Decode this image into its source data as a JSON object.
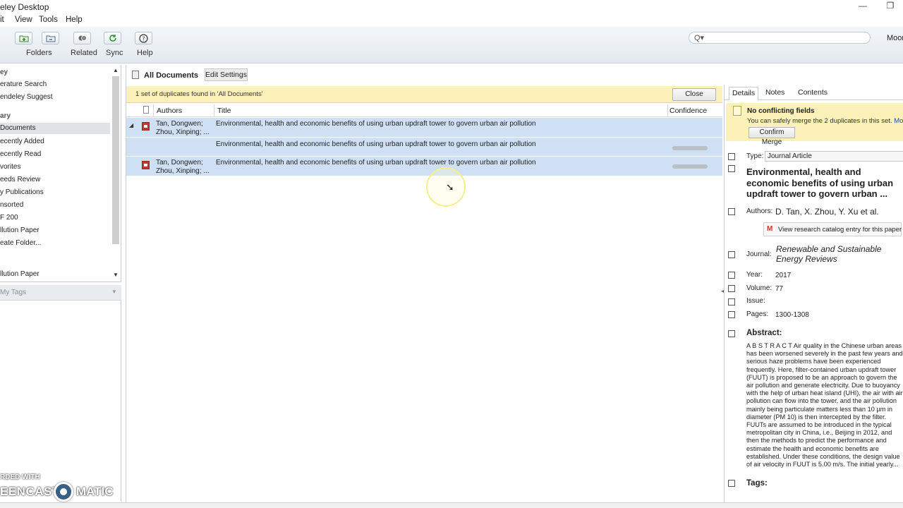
{
  "window": {
    "title": "eley Desktop",
    "minimize_glyph": "—",
    "restore_glyph": "❐"
  },
  "menu": [
    "it",
    "View",
    "Tools",
    "Help"
  ],
  "toolbar": {
    "buttons": [
      {
        "label": "Folders",
        "icon": "add-folder-icon"
      },
      {
        "label": "Related",
        "icon": "related-icon"
      },
      {
        "label": "Sync",
        "icon": "sync-icon"
      },
      {
        "label": "Help",
        "icon": "help-icon"
      }
    ],
    "search_icon": "Q▾",
    "user": "Moon"
  },
  "sidebar": {
    "items": [
      {
        "label": "ey",
        "kind": "section"
      },
      {
        "label": "erature Search",
        "kind": "item"
      },
      {
        "label": "endeley Suggest",
        "kind": "item"
      },
      {
        "label": "ary",
        "kind": "section"
      },
      {
        "label": "Documents",
        "kind": "selected"
      },
      {
        "label": "ecently Added",
        "kind": "item"
      },
      {
        "label": "ecently Read",
        "kind": "item"
      },
      {
        "label": "vorites",
        "kind": "item"
      },
      {
        "label": "eeds Review",
        "kind": "item"
      },
      {
        "label": "y Publications",
        "kind": "item"
      },
      {
        "label": "nsorted",
        "kind": "item"
      },
      {
        "label": "F 200",
        "kind": "item"
      },
      {
        "label": "llution Paper",
        "kind": "item"
      },
      {
        "label": "eate Folder...",
        "kind": "item"
      },
      {
        "label": "llution Paper",
        "kind": "item"
      }
    ],
    "tags_label": "My Tags"
  },
  "center": {
    "title": "All Documents",
    "edit_settings": "Edit Settings",
    "duplicate_notice": "1 set of duplicates found in 'All Documents'",
    "close_label": "Close",
    "columns": {
      "authors": "Authors",
      "title": "Title",
      "confidence": "Confidence"
    },
    "rows": [
      {
        "authors": "Tan, Dongwen;\nZhou, Xinping; ...",
        "title": "Environmental, health and economic benefits of using urban updraft tower to govern urban air pollution",
        "has_pdf": true,
        "expander": "◢",
        "confidence": null
      },
      {
        "authors": "",
        "title": "Environmental, health and economic benefits of using urban updraft tower to govern urban air pollution",
        "has_pdf": false,
        "expander": "",
        "confidence": "high"
      },
      {
        "authors": "Tan, Dongwen;\nZhou, Xinping; ...",
        "title": "Environmental, health and economic benefits of using urban updraft tower to govern urban air pollution",
        "has_pdf": true,
        "expander": "",
        "confidence": "high"
      }
    ]
  },
  "details": {
    "tabs": [
      "Details",
      "Notes",
      "Contents"
    ],
    "merge_title": "No conflicting fields",
    "merge_text": "You can safely merge the 2 duplicates in this set.",
    "merge_link": "More",
    "confirm_label": "Confirm Merge",
    "type_label": "Type:",
    "type_value": "Journal Article",
    "doc_title": "Environmental, health and economic benefits of using urban updraft tower to govern urban ...",
    "authors_label": "Authors:",
    "authors_value": "D. Tan, X. Zhou, Y. Xu et al.",
    "catalog_label": "View research catalog entry for this paper",
    "journal_label": "Journal:",
    "journal_value": "Renewable and Sustainable Energy Reviews",
    "year_label": "Year:",
    "year_value": "2017",
    "volume_label": "Volume:",
    "volume_value": "77",
    "issue_label": "Issue:",
    "issue_value": "",
    "pages_label": "Pages:",
    "pages_value": "1300-1308",
    "abstract_label": "Abstract:",
    "abstract_text": "A B S T R A C T Air quality in the Chinese urban areas has been worsened severely in the past few years and serious haze problems have been experienced frequently. Here, filter-contained urban updraft tower (FUUT) is proposed to be an approach to govern the air pollution and generate electricity. Due to buoyancy with the help of urban heat island (UHI), the air with air pollution can flow into the tower, and the air pollution mainly being particulate matters less than 10 µm in diameter (PM 10) is then intercepted by the filter. FUUTs are assumed to be introduced in the typical metropolitan city in China, i.e., Beijing in 2012, and then the methods to predict the performance and estimate the health and economic benefits are established. Under these conditions, the design value of air velocity in FUUT is 5.00 m/s. The initial yearly...",
    "tags_label": "Tags:"
  },
  "watermark": {
    "line1": "RDED WITH",
    "line2": "EENCAST",
    "line3": "MATIC"
  }
}
